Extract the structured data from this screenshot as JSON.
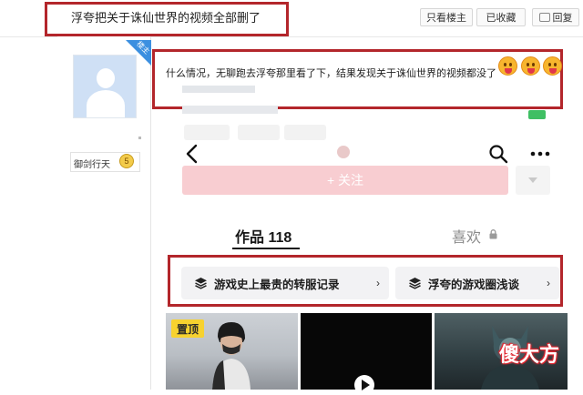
{
  "forum": {
    "thread_title": "浮夸把关于诛仙世界的视频全部删了",
    "buttons": {
      "only_owner": "只看楼主",
      "favorited": "已收藏",
      "reply": "回复"
    },
    "owner_tag": "楼主",
    "user": {
      "name": "御剑行天",
      "level_badge": "5"
    },
    "post_text": "什么情况，无聊跑去浮夸那里看了下，结果发现关于诛仙世界的视频都没了",
    "emoji_icons": [
      "yum-face-icon",
      "yum-face-icon",
      "yum-face-icon"
    ]
  },
  "profile": {
    "follow_label": "+ 关注",
    "tabs": {
      "works": "作品 118",
      "likes": "喜欢"
    },
    "collections": [
      {
        "label": "游戏史上最贵的转服记录",
        "icon": "collection-stack-icon"
      },
      {
        "label": "浮夸的游戏圈浅谈",
        "icon": "collection-stack-icon"
      }
    ],
    "pin_badge": "置顶"
  },
  "watermark": "傻大方",
  "colors": {
    "highlight_red": "#b3262b",
    "follow_pink": "#f8cdd1",
    "pin_yellow": "#f7d22f",
    "owner_tag_blue": "#3b8fe0"
  }
}
